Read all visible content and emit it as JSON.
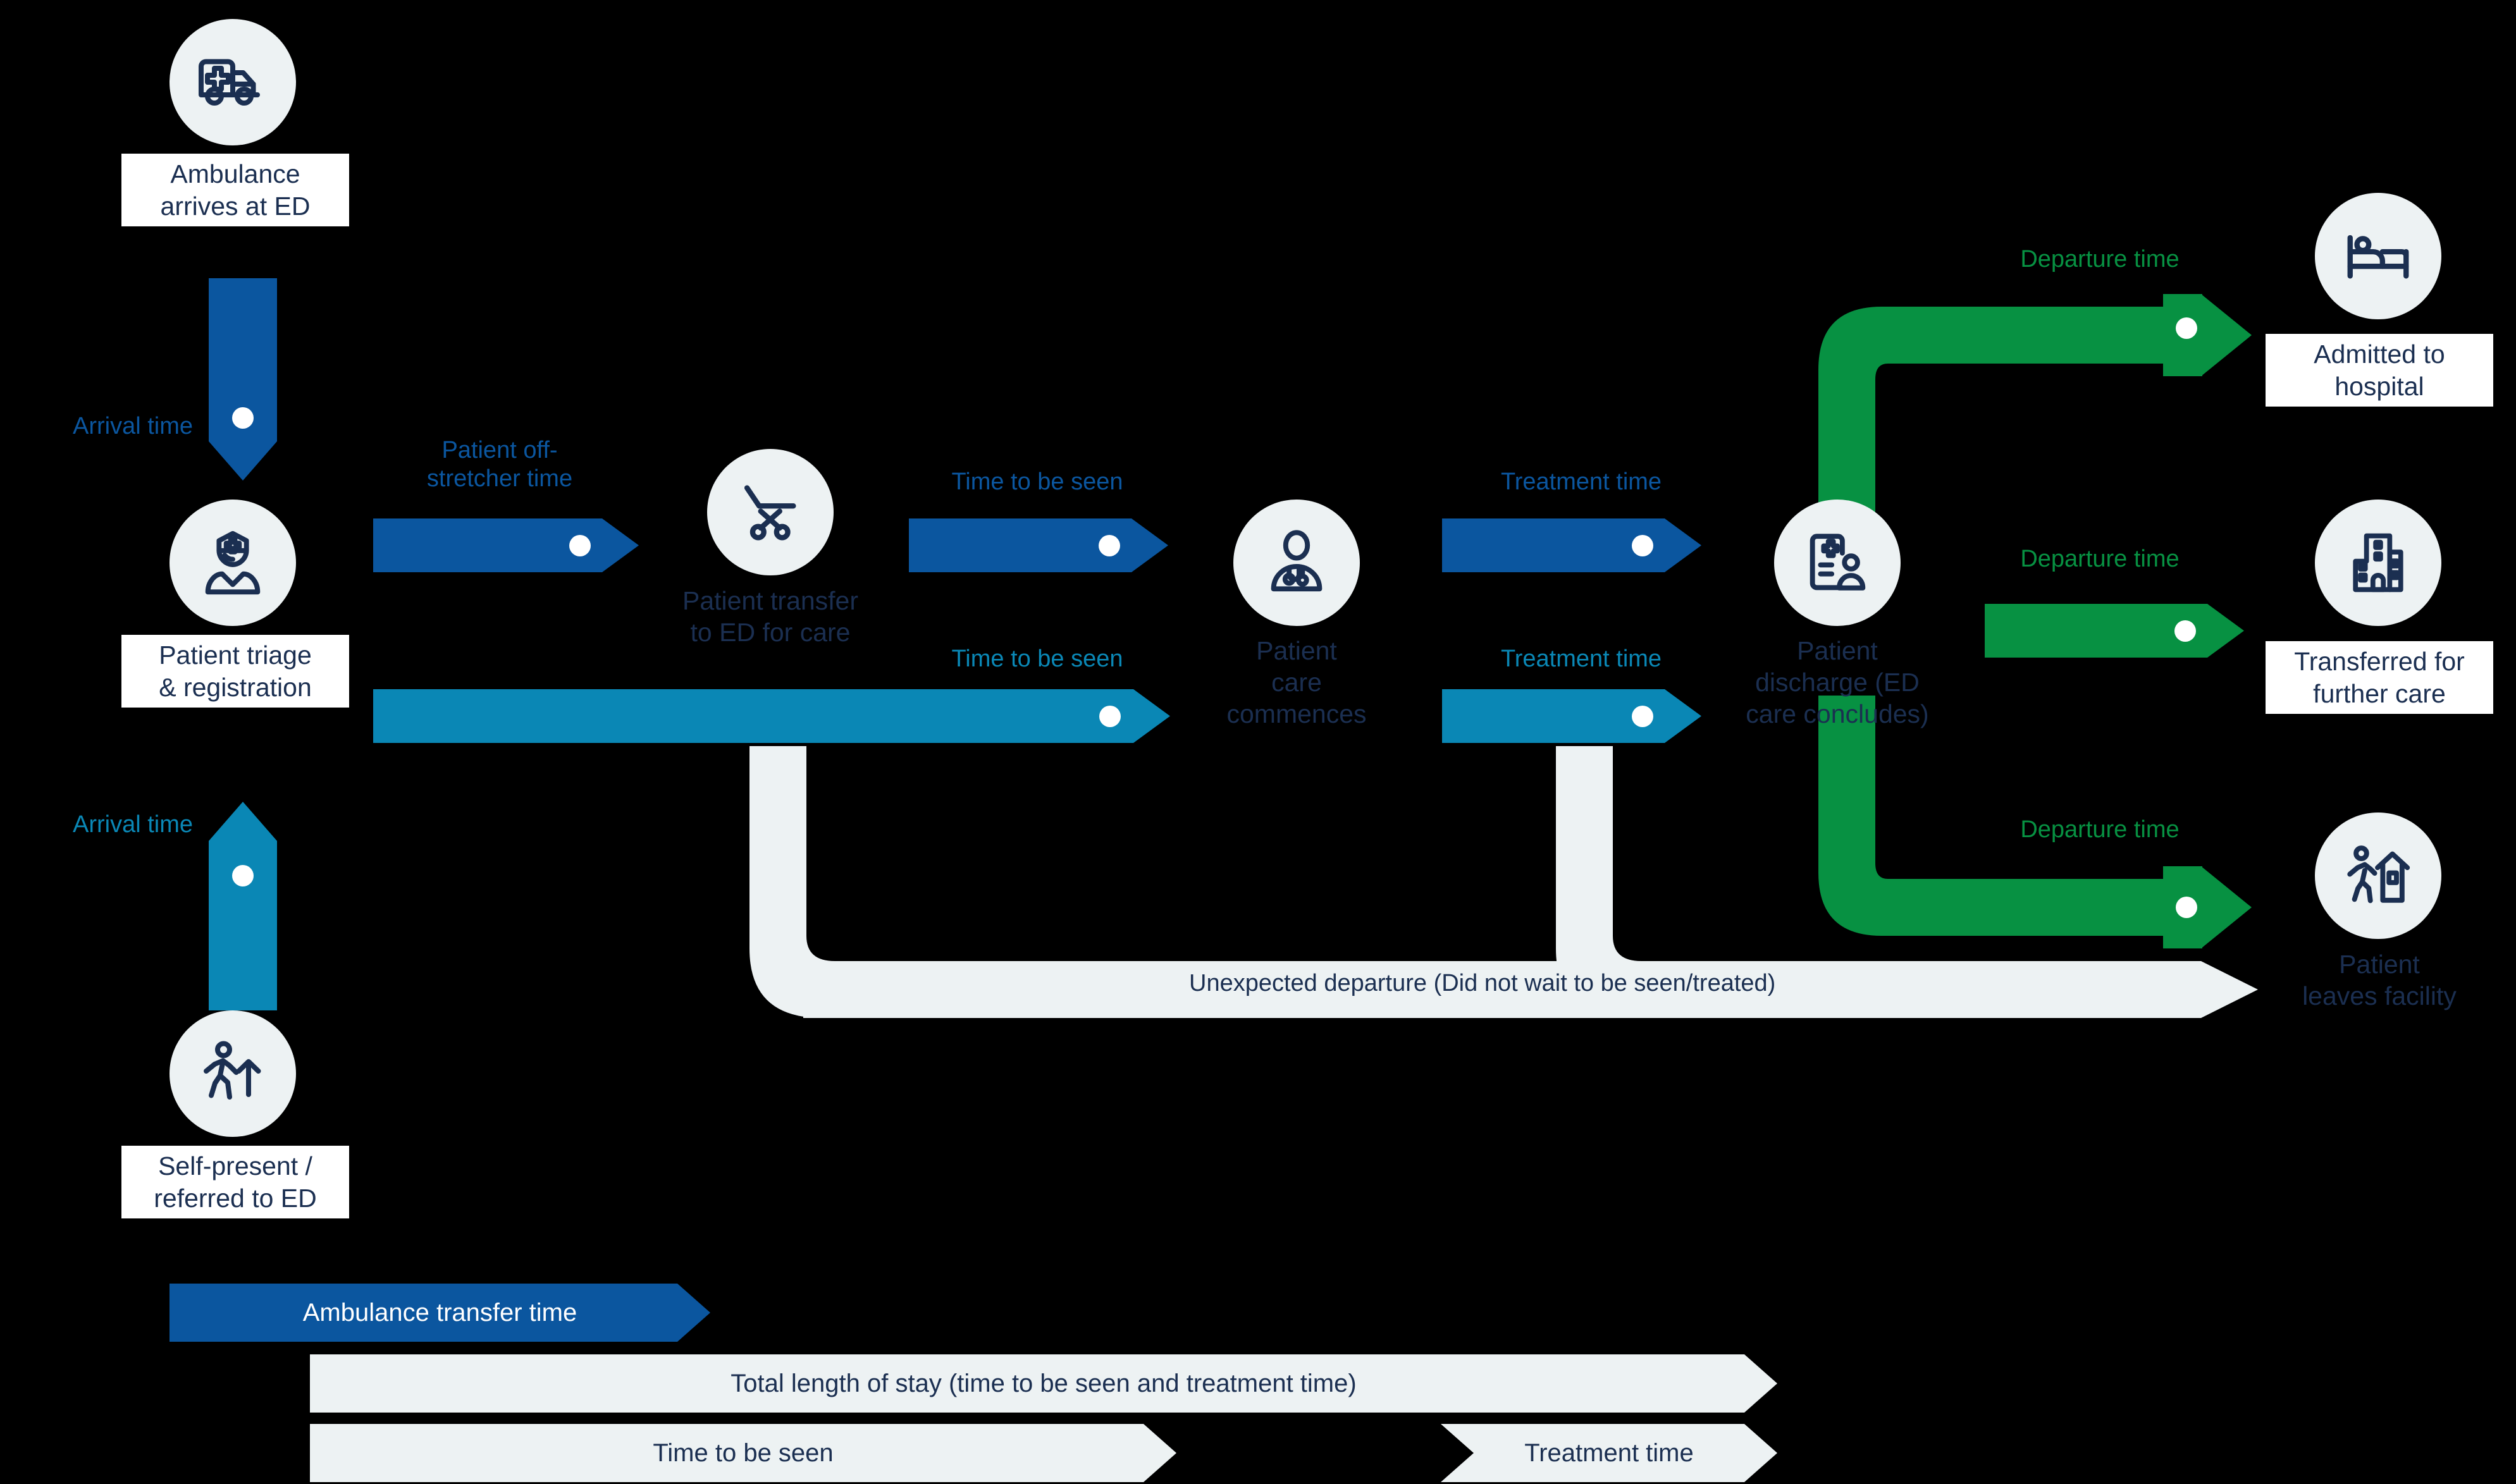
{
  "colors": {
    "navy_blue": "#0B569F",
    "cyan_blue": "#0A87B5",
    "green": "#079142",
    "pale": "#EDF2F3",
    "text_navy": "#1B2F51",
    "background": "#000000"
  },
  "nodes": {
    "ambulance_arrives": "Ambulance\narrives at ED",
    "patient_triage": "Patient triage\n& registration",
    "self_present": "Self-present /\nreferred to ED",
    "patient_transfer": "Patient transfer\nto ED for care",
    "patient_care_commences": "Patient\ncare\ncommences",
    "patient_discharge": "Patient\ndischarge (ED\ncare concludes)",
    "admitted_to_hospital": "Admitted to\nhospital",
    "transferred_further_care": "Transferred for\nfurther care",
    "patient_leaves_facility": "Patient\nleaves facility"
  },
  "arrows": {
    "arrival_time_top": "Arrival time",
    "arrival_time_bottom": "Arrival time",
    "patient_off_stretcher": "Patient off-\nstretcher time",
    "time_to_be_seen_top": "Time to be seen",
    "time_to_be_seen_bottom": "Time to be seen",
    "treatment_time_top": "Treatment time",
    "treatment_time_bottom": "Treatment time",
    "departure_time_admitted": "Departure time",
    "departure_time_transferred": "Departure time",
    "departure_time_leaves": "Departure time",
    "unexpected_departure": "Unexpected departure (Did not wait to be seen/treated)"
  },
  "legend": {
    "ambulance_transfer_time": "Ambulance transfer time",
    "total_length_of_stay": "Total length of stay (time to be seen and treatment time)",
    "time_to_be_seen": "Time to be seen",
    "treatment_time": "Treatment time"
  },
  "icons": {
    "ambulance": "ambulance-icon",
    "nurse": "nurse-icon",
    "pedestrian": "pedestrian-icon",
    "stretcher": "stretcher-icon",
    "doctor": "doctor-icon",
    "discharge": "discharge-icon",
    "bed": "bed-icon",
    "hospital": "hospital-icon",
    "home": "home-icon"
  }
}
